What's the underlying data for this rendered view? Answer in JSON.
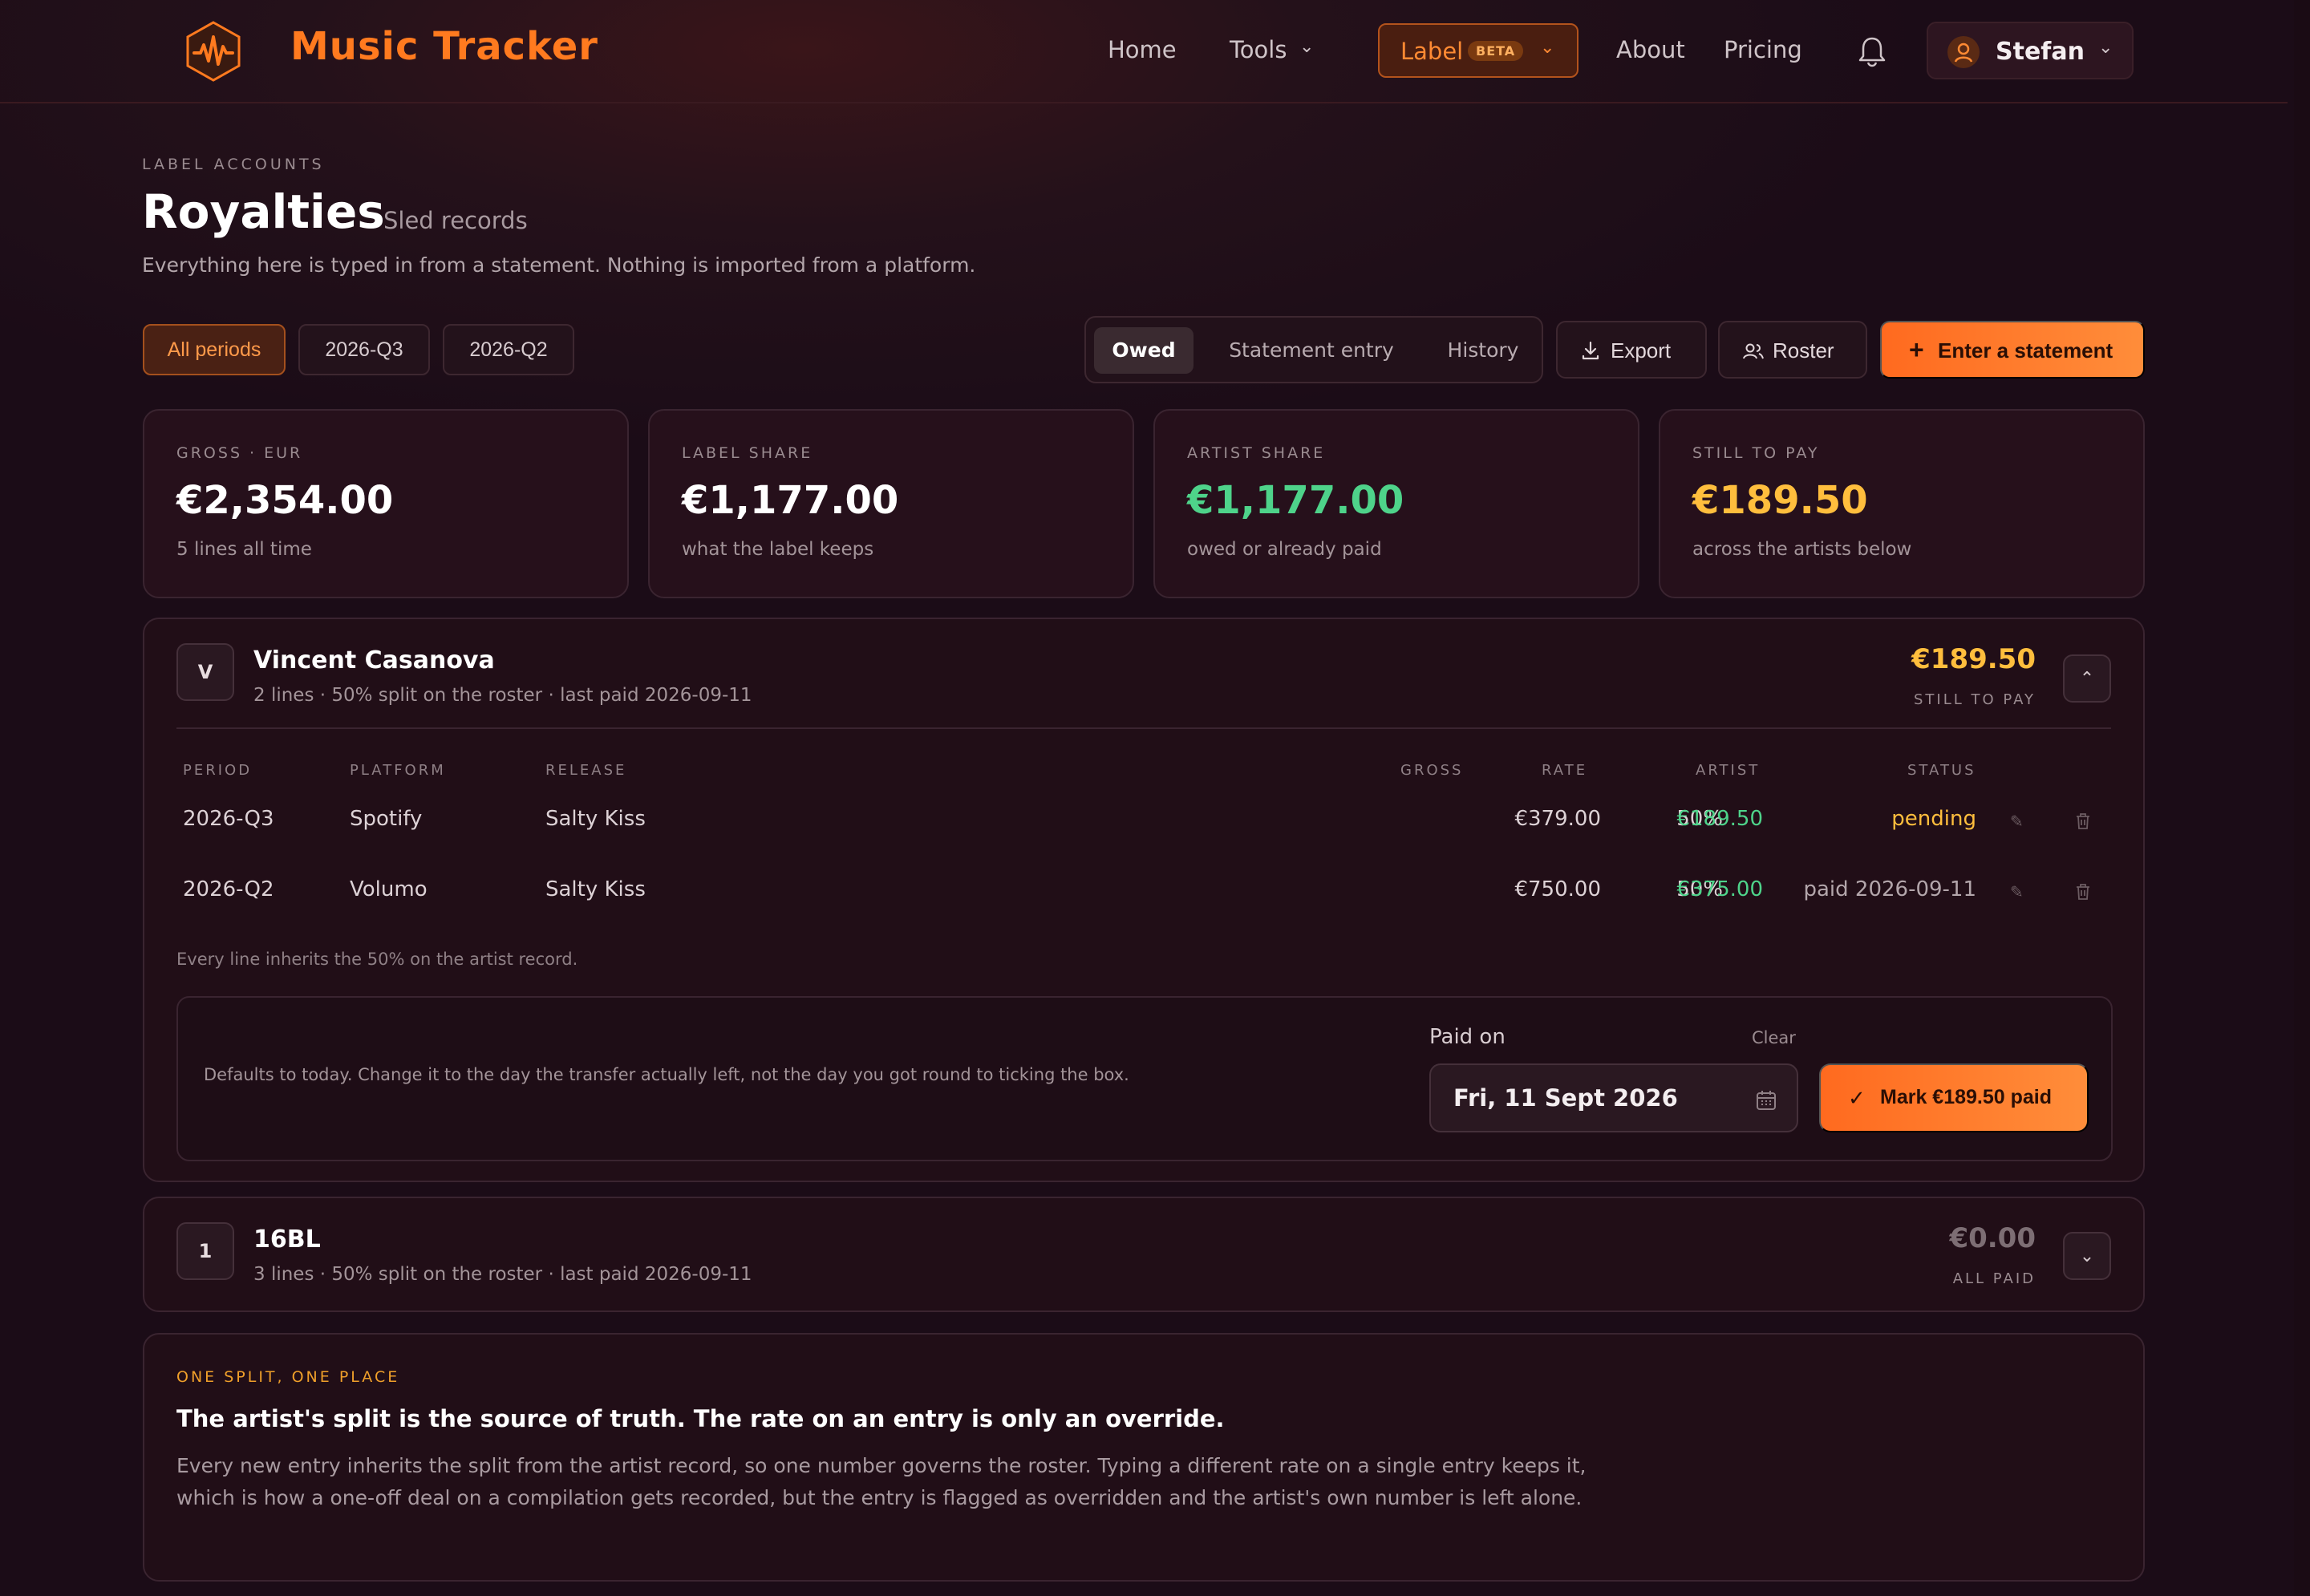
{
  "app": {
    "title": "Music Tracker"
  },
  "nav": {
    "home": "Home",
    "tools": "Tools",
    "label": "Label",
    "label_badge": "BETA",
    "about": "About",
    "pricing": "Pricing",
    "user": "Stefan"
  },
  "page": {
    "eyebrow": "LABEL ACCOUNTS",
    "title": "Royalties",
    "subtitle": "Sled records",
    "description": "Everything here is typed in from a statement. Nothing is imported from a platform."
  },
  "periods": [
    "All periods",
    "2026-Q3",
    "2026-Q2"
  ],
  "views": [
    "Owed",
    "Statement entry",
    "History"
  ],
  "actions": {
    "export": "Export",
    "roster": "Roster",
    "enter": "Enter a statement"
  },
  "stats": [
    {
      "label": "GROSS · EUR",
      "value": "€2,354.00",
      "sub": "5 lines all time",
      "color": "#ffffff"
    },
    {
      "label": "LABEL SHARE",
      "value": "€1,177.00",
      "sub": "what the label keeps",
      "color": "#ffffff"
    },
    {
      "label": "ARTIST SHARE",
      "value": "€1,177.00",
      "sub": "owed or already paid",
      "color": "#4ed38a"
    },
    {
      "label": "STILL TO PAY",
      "value": "€189.50",
      "sub": "across the artists below",
      "color": "#ffbe3d"
    }
  ],
  "artists": [
    {
      "initial": "V",
      "name": "Vincent Casanova",
      "meta": "2 lines · 50% split on the roster · last paid 2026-09-11",
      "amount": "€189.50",
      "amount_label": "STILL TO PAY",
      "columns": [
        "PERIOD",
        "PLATFORM",
        "RELEASE",
        "GROSS",
        "RATE",
        "ARTIST",
        "STATUS"
      ],
      "rows": [
        {
          "period": "2026-Q3",
          "platform": "Spotify",
          "release": "Salty Kiss",
          "gross": "€379.00",
          "rate": "50%",
          "artist": "€189.50",
          "status": "pending"
        },
        {
          "period": "2026-Q2",
          "platform": "Volumo",
          "release": "Salty Kiss",
          "gross": "€750.00",
          "rate": "50%",
          "artist": "€375.00",
          "status": "paid 2026-09-11"
        }
      ],
      "note": "Every line inherits the 50% on the artist record.",
      "pay": {
        "hint": "Defaults to today. Change it to the day the transfer actually left, not the day you got round to ticking the box.",
        "paid_on_label": "Paid on",
        "clear": "Clear",
        "date": "Fri, 11 Sept 2026",
        "button": "Mark €189.50 paid"
      }
    },
    {
      "initial": "1",
      "name": "16BL",
      "meta": "3 lines · 50% split on the roster · last paid 2026-09-11",
      "amount": "€0.00",
      "amount_label": "ALL PAID"
    }
  ],
  "info": {
    "eyebrow": "ONE SPLIT, ONE PLACE",
    "title": "The artist's split is the source of truth. The rate on an entry is only an override.",
    "body": "Every new entry inherits the split from the artist record, so one number governs the roster. Typing a different rate on a single entry keeps it, which is how a one-off deal on a compilation gets recorded, but the entry is flagged as overridden and the artist's own number is left alone."
  },
  "colors": {
    "accent": "#ff7a1f",
    "positive": "#4ed38a",
    "warning": "#ffbe3d"
  }
}
